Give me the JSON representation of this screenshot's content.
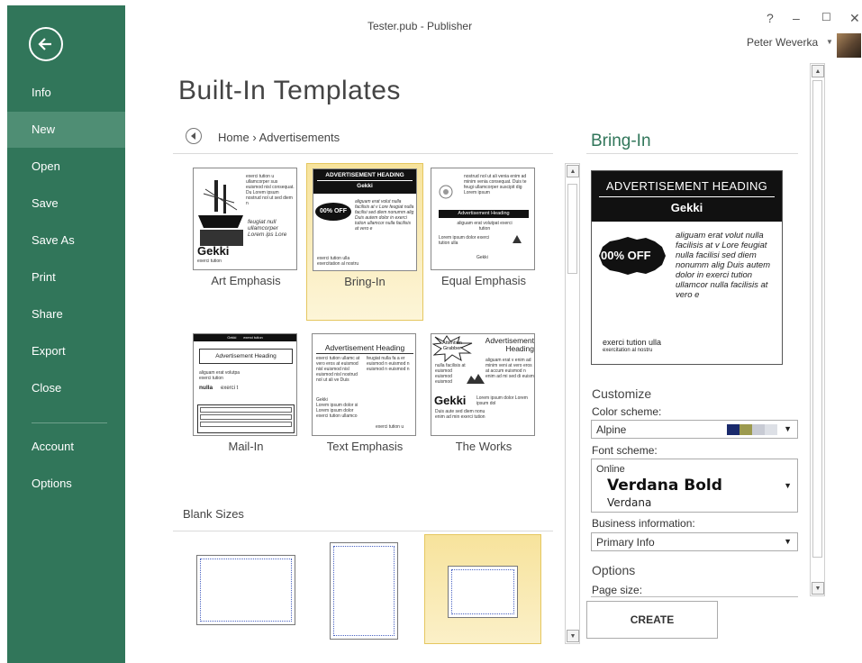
{
  "window": {
    "title": "Tester.pub - Publisher",
    "help": "?",
    "minimize": "–",
    "maximize": "☐",
    "close": "✕",
    "user_name": "Peter Weverka"
  },
  "nav": {
    "items": [
      {
        "label": "Info"
      },
      {
        "label": "New"
      },
      {
        "label": "Open"
      },
      {
        "label": "Save"
      },
      {
        "label": "Save As"
      },
      {
        "label": "Print"
      },
      {
        "label": "Share"
      },
      {
        "label": "Export"
      },
      {
        "label": "Close"
      },
      {
        "label": "Account"
      },
      {
        "label": "Options"
      }
    ],
    "active": "New"
  },
  "page_title": "Built-In Templates",
  "breadcrumb": {
    "home": "Home",
    "separator": "›",
    "current": "Advertisements"
  },
  "templates": [
    {
      "label": "Art Emphasis",
      "selected": false
    },
    {
      "label": "Bring-In",
      "selected": true
    },
    {
      "label": "Equal Emphasis",
      "selected": false
    },
    {
      "label": "Mail-In",
      "selected": false
    },
    {
      "label": "Text Emphasis",
      "selected": false
    },
    {
      "label": "The Works",
      "selected": false
    }
  ],
  "thumb_text": {
    "ad_heading_caps": "ADVERTISEMENT HEADING",
    "ad_heading": "Advertisement Heading",
    "ad_heading_mail": "Advertisement Heading",
    "gekki": "Gekki",
    "pct_off": "00% OFF",
    "attention": "Attention Grabber",
    "body1": "aliguam erat volut nulla facilisis at v",
    "art_italic": "feugiat null ullamcorper Lorem ips Lore",
    "exerci": "exerci tution",
    "gekki_tiny": "Gekki",
    "exerci_tution": "exerci tution u",
    "mail_nulla": "nulla",
    "mail_exerci": "exerci t"
  },
  "blank_sizes_label": "Blank Sizes",
  "preview": {
    "title": "Bring-In",
    "heading": "ADVERTISEMENT HEADING",
    "sub": "Gekki",
    "burst": "00% OFF",
    "body": "aliguam erat volut nulla facilisis at v Lore feugiat nulla facilisi sed diem nonumm alig Duis autem dolor in exerci tution ullamcor nulla facilisis at vero e",
    "footer1": "exerci tution ulla",
    "footer2": "exercitation al  nostru"
  },
  "customize": {
    "title": "Customize",
    "color_scheme_label": "Color scheme:",
    "color_scheme_value": "Alpine",
    "swatches": [
      "#1a2a6c",
      "#9c9a4e",
      "#c8cbd4",
      "#dde0e6"
    ],
    "font_scheme_label": "Font scheme:",
    "font_scheme_name": "Online",
    "font_major": "Verdana Bold",
    "font_minor": "Verdana",
    "business_label": "Business information:",
    "business_value": "Primary Info"
  },
  "options": {
    "title": "Options",
    "page_size_label": "Page size:"
  },
  "create_label": "CREATE",
  "colors": {
    "nav_bg": "#31765a",
    "nav_active": "#4f8e74",
    "accent_text": "#31765a",
    "selected_tile": "#f7e39c"
  }
}
